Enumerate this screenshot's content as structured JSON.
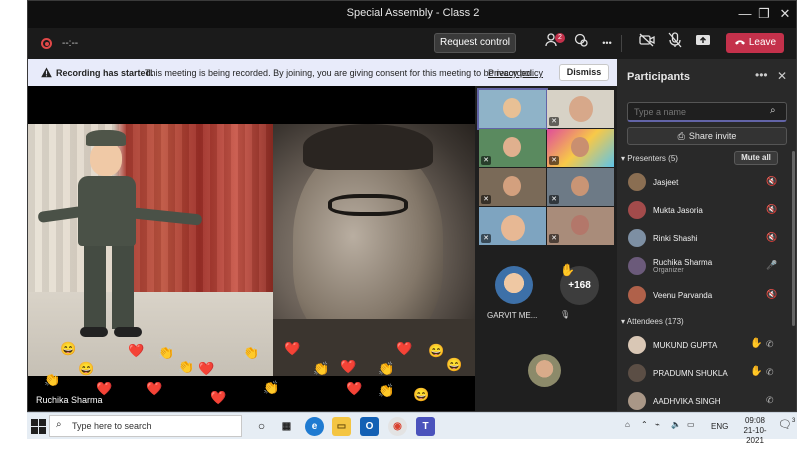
{
  "window": {
    "title": "Special Assembly - Class 2",
    "minimize_glyph": "—",
    "maximize_glyph": "❐",
    "close_glyph": "✕"
  },
  "toolbar": {
    "timer": "--:--",
    "request_control_label": "Request control",
    "participants_badge": "2",
    "more_glyph": "•••",
    "leave_label": "Leave",
    "icons": [
      "participants-icon",
      "chat-icon",
      "more-icon",
      "camera-off-icon",
      "mic-off-icon",
      "share-icon",
      "phone-icon"
    ]
  },
  "banner": {
    "title": "Recording has started.",
    "message": "This meeting is being recorded. By joining, you are giving consent for this meeting to be recorded.",
    "link": "Privacy policy",
    "dismiss_label": "Dismiss"
  },
  "stage": {
    "presenter_name": "Ruchika Sharma"
  },
  "gallery": {
    "featured_name": "GARVIT ME...",
    "more_count": "+168"
  },
  "panel": {
    "title": "Participants",
    "more_glyph": "•••",
    "close_glyph": "✕",
    "search_placeholder": "Type a name",
    "share_invite_label": "Share invite",
    "presenters_heading": "Presenters (5)",
    "mute_all_label": "Mute all",
    "attendees_heading": "Attendees (173)",
    "presenters": [
      {
        "name": "Jasjeet",
        "role": "",
        "mic": "muted",
        "color": "#8a6e52"
      },
      {
        "name": "Mukta Jasoria",
        "role": "",
        "mic": "muted",
        "color": "#a34b4b"
      },
      {
        "name": "Rinki Shashi",
        "role": "",
        "mic": "muted",
        "color": "#7d8fa3"
      },
      {
        "name": "Ruchika Sharma",
        "role": "Organizer",
        "mic": "on",
        "color": "#6b5a7a"
      },
      {
        "name": "Veenu Parvanda",
        "role": "",
        "mic": "muted",
        "color": "#b0614a"
      }
    ],
    "attendees": [
      {
        "name": "MUKUND GUPTA",
        "hand": true,
        "color": "#d9c7b5"
      },
      {
        "name": "PRADUMN SHUKLA",
        "hand": true,
        "color": "#5b4e45"
      },
      {
        "name": "AADHVIKA SINGH",
        "hand": false,
        "color": "#a99787"
      }
    ]
  },
  "taskbar": {
    "search_placeholder": "Type here to search",
    "language": "ENG",
    "time": "09:08",
    "date": "21-10-2021",
    "notification_count": "3"
  },
  "colors": {
    "accent": "#6264a7",
    "leave": "#c4314b",
    "banner_bg": "#e8ebfa",
    "raised_hand": "#f2b43c",
    "heart": "#d93434"
  }
}
